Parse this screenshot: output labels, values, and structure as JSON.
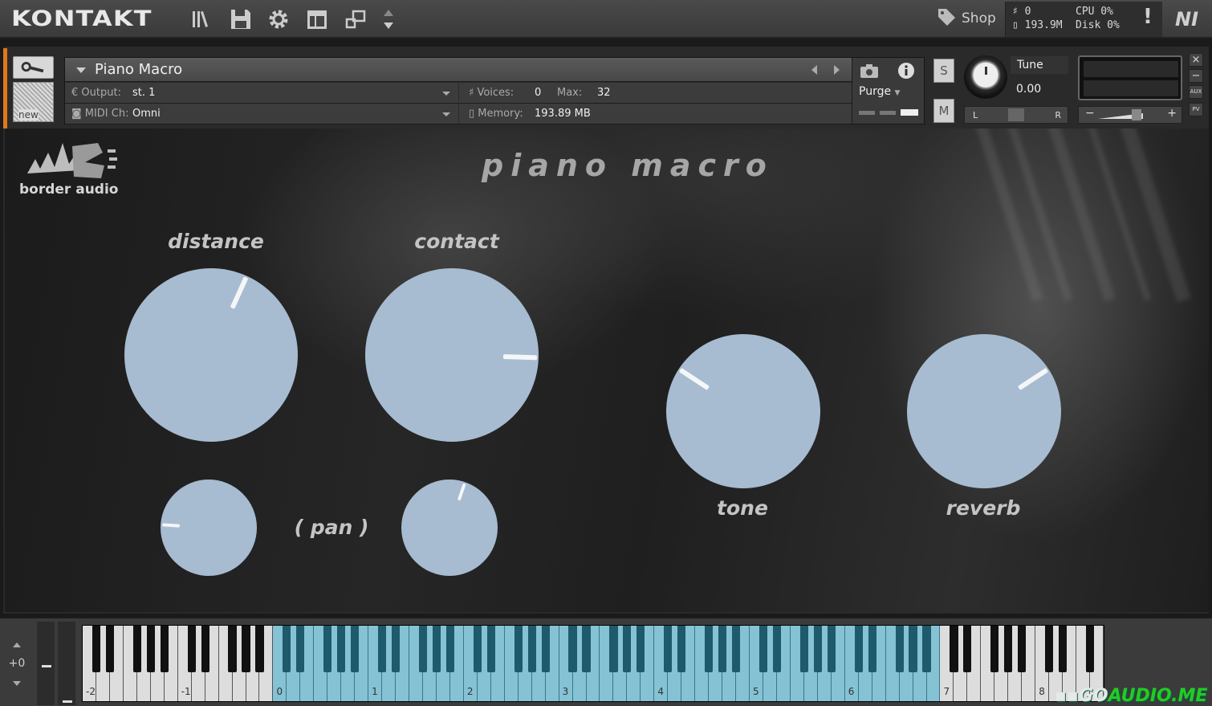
{
  "app": {
    "logo": "KONTAKT"
  },
  "topbar": {
    "shop_label": "Shop",
    "voices": "0",
    "memory": "193.9M",
    "cpu": "CPU 0%",
    "disk": "Disk 0%",
    "alert": "!",
    "brand": "NI"
  },
  "instrument": {
    "title": "Piano Macro",
    "output_label": "Output:",
    "output_value": "st. 1",
    "midi_label": "MIDI Ch:",
    "midi_value": "Omni",
    "voices_label": "Voices:",
    "voices_value": "0",
    "max_label": "Max:",
    "max_value": "32",
    "memory_label": "Memory:",
    "memory_value": "193.89 MB",
    "purge_label": "Purge",
    "new_label": "new",
    "solo": "S",
    "mute": "M",
    "tune_label": "Tune",
    "tune_value": "0.00",
    "pan_l": "L",
    "pan_r": "R",
    "vol_minus": "−",
    "vol_plus": "+",
    "close": "×",
    "minimize": "−",
    "aux": "AUX",
    "pv": "PV"
  },
  "performance": {
    "brand_text": "border audio",
    "title": "piano macro",
    "knobs": {
      "distance": {
        "label": "distance",
        "value": 0.59
      },
      "contact": {
        "label": "contact",
        "value": 0.84
      },
      "tone": {
        "label": "tone",
        "value": 0.29
      },
      "reverb": {
        "label": "reverb",
        "value": 0.71
      },
      "distance_pan": {
        "value": 0.18
      },
      "contact_pan": {
        "value": 0.57
      }
    },
    "pan_label": "( pan )"
  },
  "keyboard": {
    "octave_shift": "+0",
    "octave_labels": [
      "-2",
      "-1",
      "0",
      "1",
      "2",
      "3",
      "4",
      "5",
      "6",
      "7",
      "8"
    ]
  },
  "watermark": {
    "prefix": "GO",
    "text": "AUDIO.ME"
  },
  "icons": [
    "library-icon",
    "save-icon",
    "gear-icon",
    "view-icon",
    "resize-icon",
    "cpu-arrows-icon",
    "tag-icon",
    "wrench-icon",
    "camera-icon",
    "info-icon"
  ]
}
